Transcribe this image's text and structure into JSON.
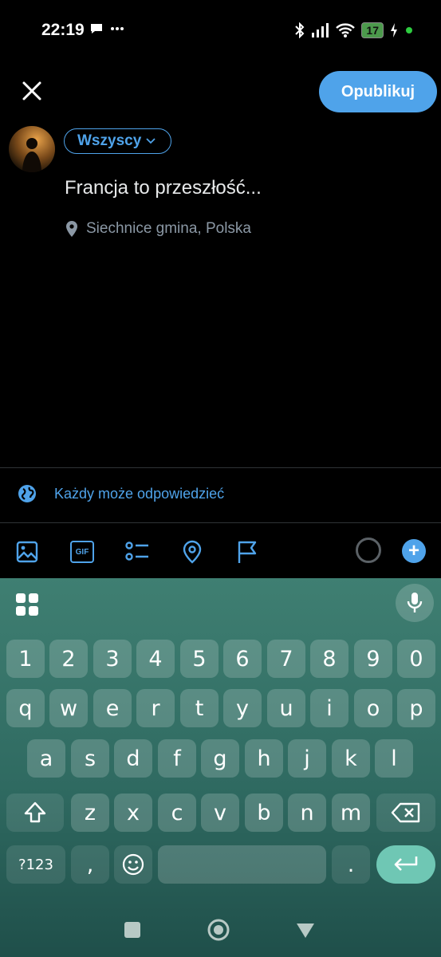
{
  "status": {
    "time": "22:19",
    "battery": "17"
  },
  "header": {
    "publish_label": "Opublikuj"
  },
  "composer": {
    "audience_label": "Wszyscy",
    "text": "Francja to przeszłość...",
    "location": "Siechnice gmina, Polska"
  },
  "reply_setting": {
    "label": "Każdy może odpowiedzieć"
  },
  "toolbar": {
    "gif_label": "GIF",
    "add_label": "+"
  },
  "keyboard": {
    "number_row": [
      "1",
      "2",
      "3",
      "4",
      "5",
      "6",
      "7",
      "8",
      "9",
      "0"
    ],
    "row1": [
      "q",
      "w",
      "e",
      "r",
      "t",
      "y",
      "u",
      "i",
      "o",
      "p"
    ],
    "row2": [
      "a",
      "s",
      "d",
      "f",
      "g",
      "h",
      "j",
      "k",
      "l"
    ],
    "row3": [
      "z",
      "x",
      "c",
      "v",
      "b",
      "n",
      "m"
    ],
    "symbols_label": "?123",
    "comma": ",",
    "period": "."
  },
  "colors": {
    "accent": "#4fa3ea",
    "background": "#000000",
    "keyboard": "#2f6a61"
  }
}
